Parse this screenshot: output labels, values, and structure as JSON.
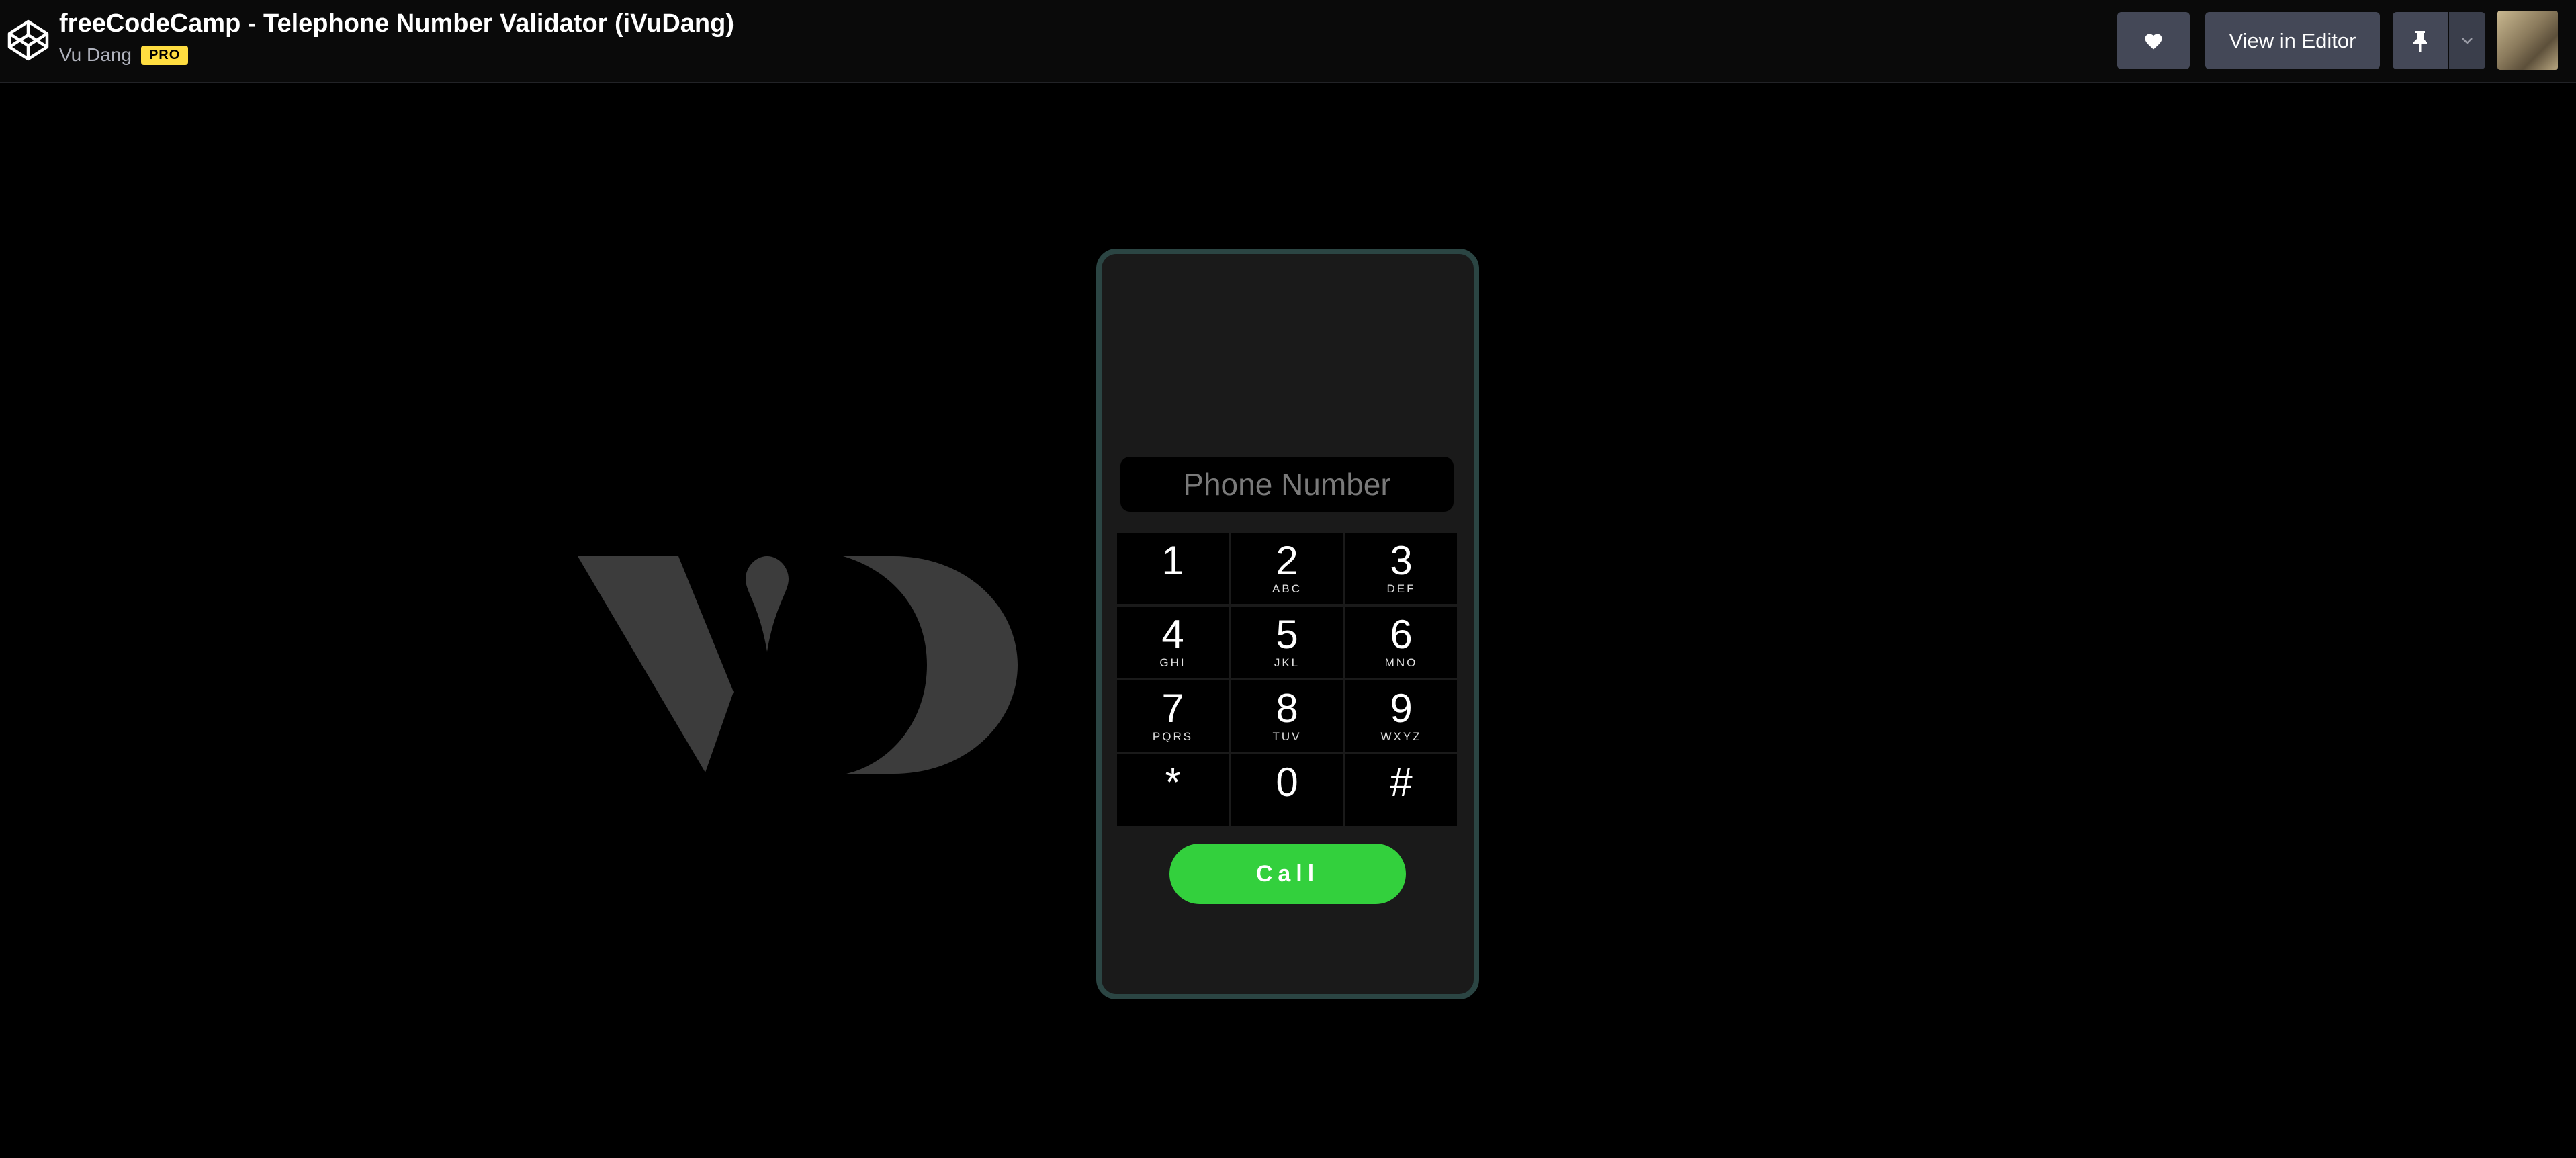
{
  "header": {
    "title": "freeCodeCamp - Telephone Number Validator (iVuDang)",
    "author": "Vu Dang",
    "badge": "PRO",
    "view_in_editor": "View in Editor",
    "icons": {
      "logo": "codepen-icon",
      "like": "heart-icon",
      "pin": "pin-icon",
      "dropdown": "chevron-down-icon"
    }
  },
  "phone": {
    "input_placeholder": "Phone Number",
    "input_value": "",
    "keys": [
      {
        "digit": "1",
        "letters": ""
      },
      {
        "digit": "2",
        "letters": "ABC"
      },
      {
        "digit": "3",
        "letters": "DEF"
      },
      {
        "digit": "4",
        "letters": "GHI"
      },
      {
        "digit": "5",
        "letters": "JKL"
      },
      {
        "digit": "6",
        "letters": "MNO"
      },
      {
        "digit": "7",
        "letters": "PQRS"
      },
      {
        "digit": "8",
        "letters": "TUV"
      },
      {
        "digit": "9",
        "letters": "WXYZ"
      },
      {
        "digit": "*",
        "letters": ""
      },
      {
        "digit": "0",
        "letters": ""
      },
      {
        "digit": "#",
        "letters": ""
      }
    ],
    "call_label": "Call"
  },
  "colors": {
    "page_bg": "#000000",
    "topbar_bg": "#0a0a0a",
    "button_bg": "#444857",
    "pro_badge": "#ffdd40",
    "phone_border": "#2b4543",
    "phone_bg": "#1a1a1a",
    "call_green": "#33d03d",
    "logo_gray": "#3c3c3c"
  }
}
